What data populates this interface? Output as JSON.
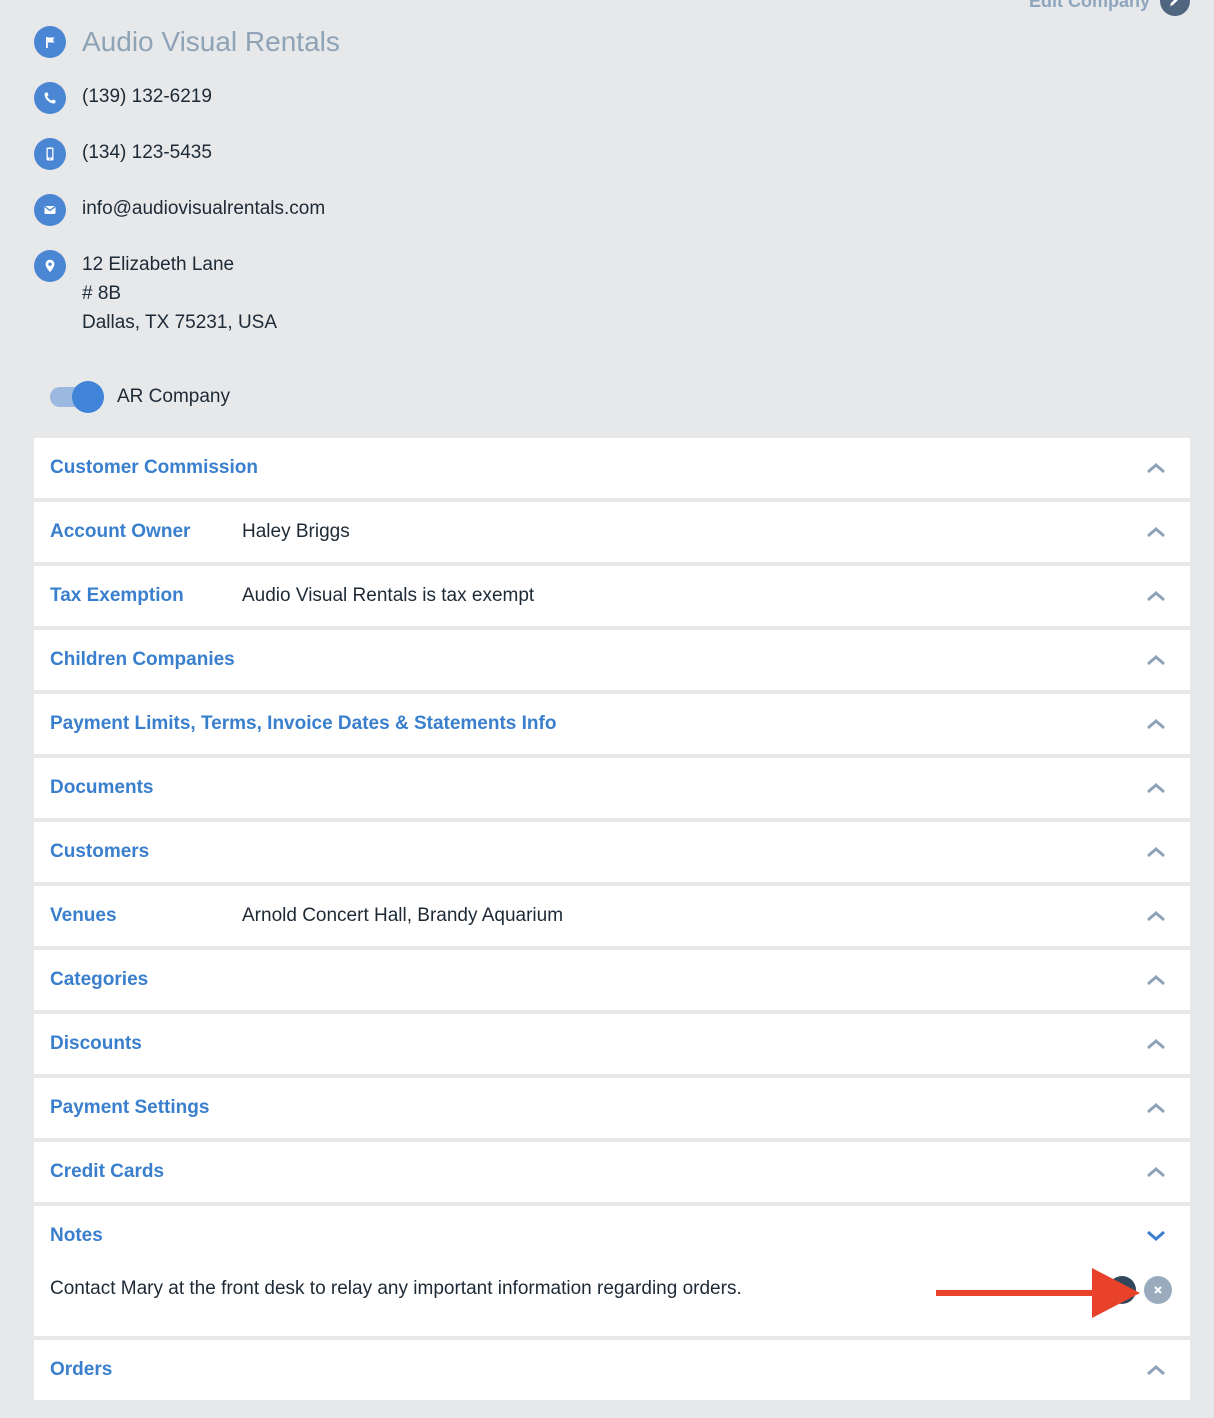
{
  "header": {
    "edit_label": "Edit Company",
    "company_name": "Audio Visual Rentals"
  },
  "contact": {
    "phone": "(139) 132-6219",
    "mobile": "(134) 123-5435",
    "email": "info@audiovisualrentals.com",
    "address_line1": "12 Elizabeth Lane",
    "address_line2": "# 8B",
    "address_line3": "Dallas, TX 75231, USA"
  },
  "ar_toggle": {
    "label": "AR Company",
    "on": true
  },
  "sections": [
    {
      "title": "Customer Commission",
      "value": ""
    },
    {
      "title": "Account Owner",
      "value": "Haley Briggs"
    },
    {
      "title": "Tax Exemption",
      "value": "Audio Visual Rentals is tax exempt"
    },
    {
      "title": "Children Companies",
      "value": ""
    },
    {
      "title": "Payment Limits, Terms, Invoice Dates & Statements Info",
      "value": ""
    },
    {
      "title": "Documents",
      "value": ""
    },
    {
      "title": "Customers",
      "value": ""
    },
    {
      "title": "Venues",
      "value": "Arnold Concert Hall, Brandy Aquarium"
    },
    {
      "title": "Categories",
      "value": ""
    },
    {
      "title": "Discounts",
      "value": ""
    },
    {
      "title": "Payment Settings",
      "value": ""
    },
    {
      "title": "Credit Cards",
      "value": ""
    },
    {
      "title": "Notes",
      "value": ""
    },
    {
      "title": "Orders",
      "value": ""
    }
  ],
  "notes": {
    "text": "Contact Mary at the front desk to relay any important information regarding orders."
  },
  "colors": {
    "accent": "#3a7fcd",
    "icon_bg": "#4a86d4",
    "arrow": "#e8432a"
  }
}
